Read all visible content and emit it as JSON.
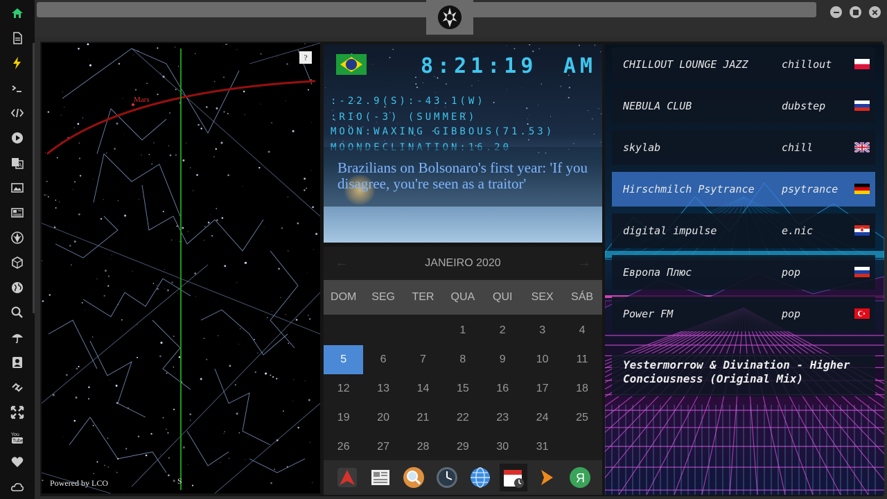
{
  "window": {
    "logo_icon": "rebel-alliance-icon",
    "controls": [
      "minimize-icon",
      "maximize-icon",
      "close-icon"
    ]
  },
  "sidebar": {
    "items": [
      {
        "name": "home-icon",
        "color": "#2ecc71"
      },
      {
        "name": "document-icon",
        "color": "#cccccc"
      },
      {
        "name": "lightning-icon",
        "color": "#f5d000"
      },
      {
        "name": "terminal-icon",
        "color": "#cccccc"
      },
      {
        "name": "code-icon",
        "color": "#cccccc"
      },
      {
        "name": "play-icon",
        "color": "#cccccc"
      },
      {
        "name": "translate-icon",
        "color": "#cccccc"
      },
      {
        "name": "image-icon",
        "color": "#cccccc"
      },
      {
        "name": "newspaper-icon",
        "color": "#cccccc"
      },
      {
        "name": "rebel-icon",
        "color": "#cccccc"
      },
      {
        "name": "hexagon-icon",
        "color": "#cccccc"
      },
      {
        "name": "globe-icon",
        "color": "#cccccc"
      },
      {
        "name": "search-icon",
        "color": "#cccccc"
      },
      {
        "name": "umbrella-icon",
        "color": "#cccccc"
      },
      {
        "name": "contact-icon",
        "color": "#cccccc"
      },
      {
        "name": "link-icon",
        "color": "#cccccc"
      },
      {
        "name": "expand-icon",
        "color": "#cccccc"
      },
      {
        "name": "youtube-icon",
        "color": "#cccccc"
      },
      {
        "name": "heart-icon",
        "color": "#cccccc"
      },
      {
        "name": "cloud-icon",
        "color": "#cccccc"
      }
    ]
  },
  "skymap": {
    "help": "?",
    "planet": "Mars",
    "credit": "Powered by LCO",
    "direction": "S"
  },
  "clock": {
    "time": "8:21:19",
    "ampm": "AM",
    "coords": ":-22.9(S):-43.1(W)",
    "location": ":RIO(-3) (SUMMER)",
    "moon": "MOON:WAXING GIBBOUS(71.53)",
    "moon_declination": "MOONDECLINATION:16.20",
    "news": "Brazilians on Bolsonaro's first year: 'If you disagree, you're seen as a traitor'",
    "flag": "brazil-flag"
  },
  "calendar": {
    "month": "JANEIRO 2020",
    "prev": "←",
    "next": "→",
    "weekdays": [
      "DOM",
      "SEG",
      "TER",
      "QUA",
      "QUI",
      "SEX",
      "SÁB"
    ],
    "weeks": [
      [
        "",
        "",
        "",
        "1",
        "2",
        "3",
        "4"
      ],
      [
        "5",
        "6",
        "7",
        "8",
        "9",
        "10",
        "11"
      ],
      [
        "12",
        "13",
        "14",
        "15",
        "16",
        "17",
        "18"
      ],
      [
        "19",
        "20",
        "21",
        "22",
        "23",
        "24",
        "25"
      ],
      [
        "26",
        "27",
        "28",
        "29",
        "30",
        "31",
        ""
      ]
    ],
    "selected": "5",
    "selected_color": "#4b89d6"
  },
  "dock": {
    "items": [
      "arch-icon",
      "news-app-icon",
      "search-app-icon",
      "clock-app-icon",
      "globe-app-icon",
      "calendar-app-icon",
      "play-app-icon",
      "yandex-icon"
    ]
  },
  "radio": {
    "stations": [
      {
        "name": "CHILLOUT LOUNGE JAZZ",
        "genre": "chillout",
        "flag": "poland-flag"
      },
      {
        "name": "NEBULA CLUB",
        "genre": "dubstep",
        "flag": "russia-flag"
      },
      {
        "name": "skylab",
        "genre": "chill",
        "flag": "uk-flag"
      },
      {
        "name": "Hirschmilch Psytrance",
        "genre": "psytrance",
        "flag": "germany-flag"
      },
      {
        "name": "digital impulse",
        "genre": "e.nic",
        "flag": "croatia-flag"
      },
      {
        "name": "Европа Плюс",
        "genre": "pop",
        "flag": "russia-flag"
      },
      {
        "name": "Power FM",
        "genre": "pop",
        "flag": "turkey-flag"
      }
    ],
    "active_index": 3,
    "now_playing": "Yestermorrow & Divination - Higher Conciousness (Original Mix)"
  }
}
